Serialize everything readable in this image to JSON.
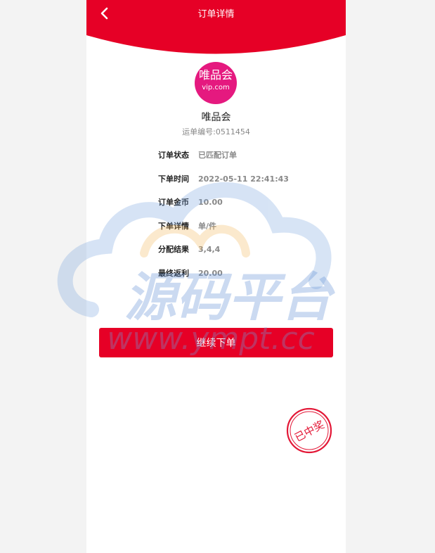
{
  "header": {
    "title": "订单详情",
    "back_icon": "chevron-left-icon",
    "color": "#e60026"
  },
  "merchant": {
    "logo_text_cn": "唯品会",
    "logo_text_en": "vip.com",
    "logo_color": "#e5197f",
    "name": "唯品会",
    "tracking_label": "运单编号:",
    "tracking_number": "0511454"
  },
  "details": [
    {
      "label": "订单状态",
      "value": "已匹配订单"
    },
    {
      "label": "下单时间",
      "value": "2022-05-11 22:41:43"
    },
    {
      "label": "订单金币",
      "value": "10.00"
    },
    {
      "label": "下单详情",
      "value": "单/件"
    },
    {
      "label": "分配结果",
      "value": "3,4,4"
    },
    {
      "label": "最终返利",
      "value": "20.00"
    }
  ],
  "actions": {
    "continue_label": "继续下单"
  },
  "stamp": {
    "text": "已中奖",
    "color": "#e31837"
  },
  "watermark": {
    "title": "源码平台",
    "url": "www.ympt.cc"
  }
}
